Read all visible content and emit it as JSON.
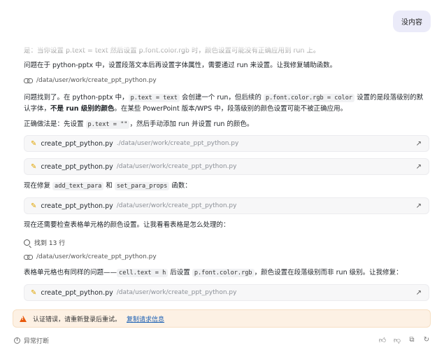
{
  "user_message": "没内容",
  "partial_line": "是：当你设置 p.text = text 然后设置 p.font.color.rgb 时，颜色设置可能没有正确应用到 run 上。",
  "para1": "问题在于 python-pptx 中，设置段落文本后再设置字体属性，需要通过 run 来设置。让我修复辅助函数。",
  "path_ref": "/data/user/work/create_ppt_python.py",
  "para2": {
    "t1": "问题找到了。在 python-pptx 中，",
    "c1": "p.text = text",
    "t2": " 会创建一个 run，但后续的 ",
    "c2": "p.font.color.rgb = color",
    "t3": " 设置的是段落级别的默认字体，",
    "b1": "不是 run 级别的颜色",
    "t4": "。在某些 PowerPoint 版本/WPS 中，段落级别的颜色设置可能不被正确应用。"
  },
  "para3": {
    "t1": "正确做法是：先设置 ",
    "c1": "p.text = \"\"",
    "t2": "，然后手动添加 run 并设置 run 的颜色。"
  },
  "tool_calls": [
    {
      "name": "create_ppt_python.py",
      "path": "./data/user/work/create_ppt_python.py"
    },
    {
      "name": "create_ppt_python.py",
      "path": "/data/user/work/create_ppt_python.py"
    },
    {
      "name": "create_ppt_python.py",
      "path": "/data/user/work/create_ppt_python.py"
    },
    {
      "name": "create_ppt_python.py",
      "path": "/data/user/work/create_ppt_python.py"
    }
  ],
  "para4": {
    "t1": "现在修复 ",
    "c1": "add_text_para",
    "t2": " 和 ",
    "c2": "set_para_props",
    "t3": " 函数："
  },
  "para5": "现在还需要检查表格单元格的颜色设置。让我看看表格是怎么处理的：",
  "search_result": "找到 13 行",
  "path_ref2": "/data/user/work/create_ppt_python.py",
  "para6": {
    "t1": "表格单元格也有同样的问题——",
    "c1": "cell.text = h",
    "t2": " 后设置 ",
    "c2": "p.font.color.rgb",
    "t3": "，颜色设置在段落级别而非 run 级别。让我修复："
  },
  "error": {
    "message": "认证错误，请重新登录后重试。",
    "link": "复制请求信息"
  },
  "footer": {
    "status": "异常打断",
    "actions": [
      "thumbs-up-icon",
      "thumbs-down-icon",
      "copy-icon",
      "refresh-icon"
    ]
  },
  "colors": {
    "accent_warn": "#e8590c",
    "link": "#1a5fb4",
    "user_bubble": "#ebebf9"
  }
}
